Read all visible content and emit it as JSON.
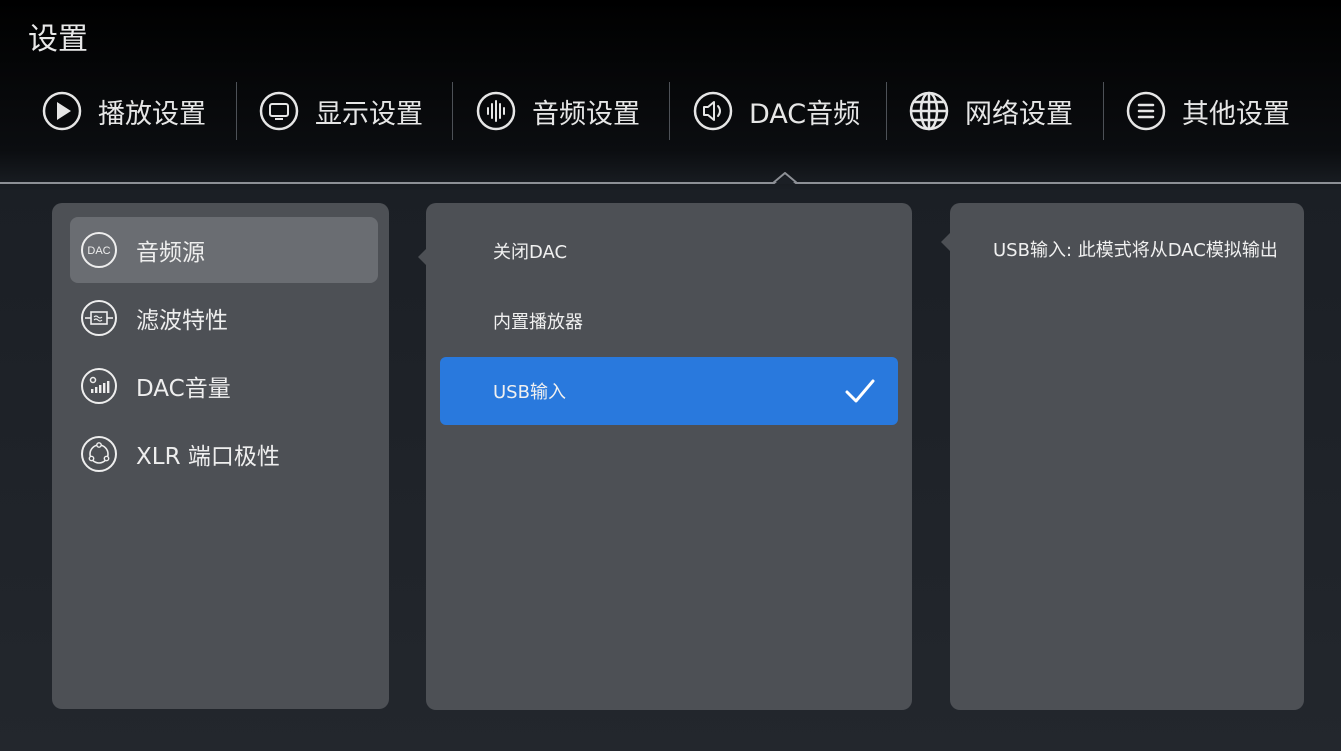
{
  "page": {
    "title": "设置"
  },
  "tabs": [
    {
      "label": "播放设置",
      "icon": "play-circle-icon"
    },
    {
      "label": "显示设置",
      "icon": "monitor-icon"
    },
    {
      "label": "音频设置",
      "icon": "audio-wave-icon"
    },
    {
      "label": "DAC音频",
      "icon": "speaker-icon",
      "active": true
    },
    {
      "label": "网络设置",
      "icon": "globe-icon"
    },
    {
      "label": "其他设置",
      "icon": "menu-lines-icon"
    }
  ],
  "sidebar": {
    "items": [
      {
        "label": "音频源",
        "icon": "dac-icon",
        "selected": true
      },
      {
        "label": "滤波特性",
        "icon": "filter-icon"
      },
      {
        "label": "DAC音量",
        "icon": "volume-bars-icon"
      },
      {
        "label": "XLR 端口极性",
        "icon": "xlr-port-icon"
      }
    ]
  },
  "options": {
    "items": [
      {
        "label": "关闭DAC"
      },
      {
        "label": "内置播放器"
      },
      {
        "label": "USB输入",
        "selected": true
      }
    ]
  },
  "description": {
    "text": "USB输入: 此模式将从DAC模拟输出"
  },
  "colors": {
    "accent": "#2979dd",
    "panel": "#4d5055",
    "selected_item": "#6a6d72"
  }
}
